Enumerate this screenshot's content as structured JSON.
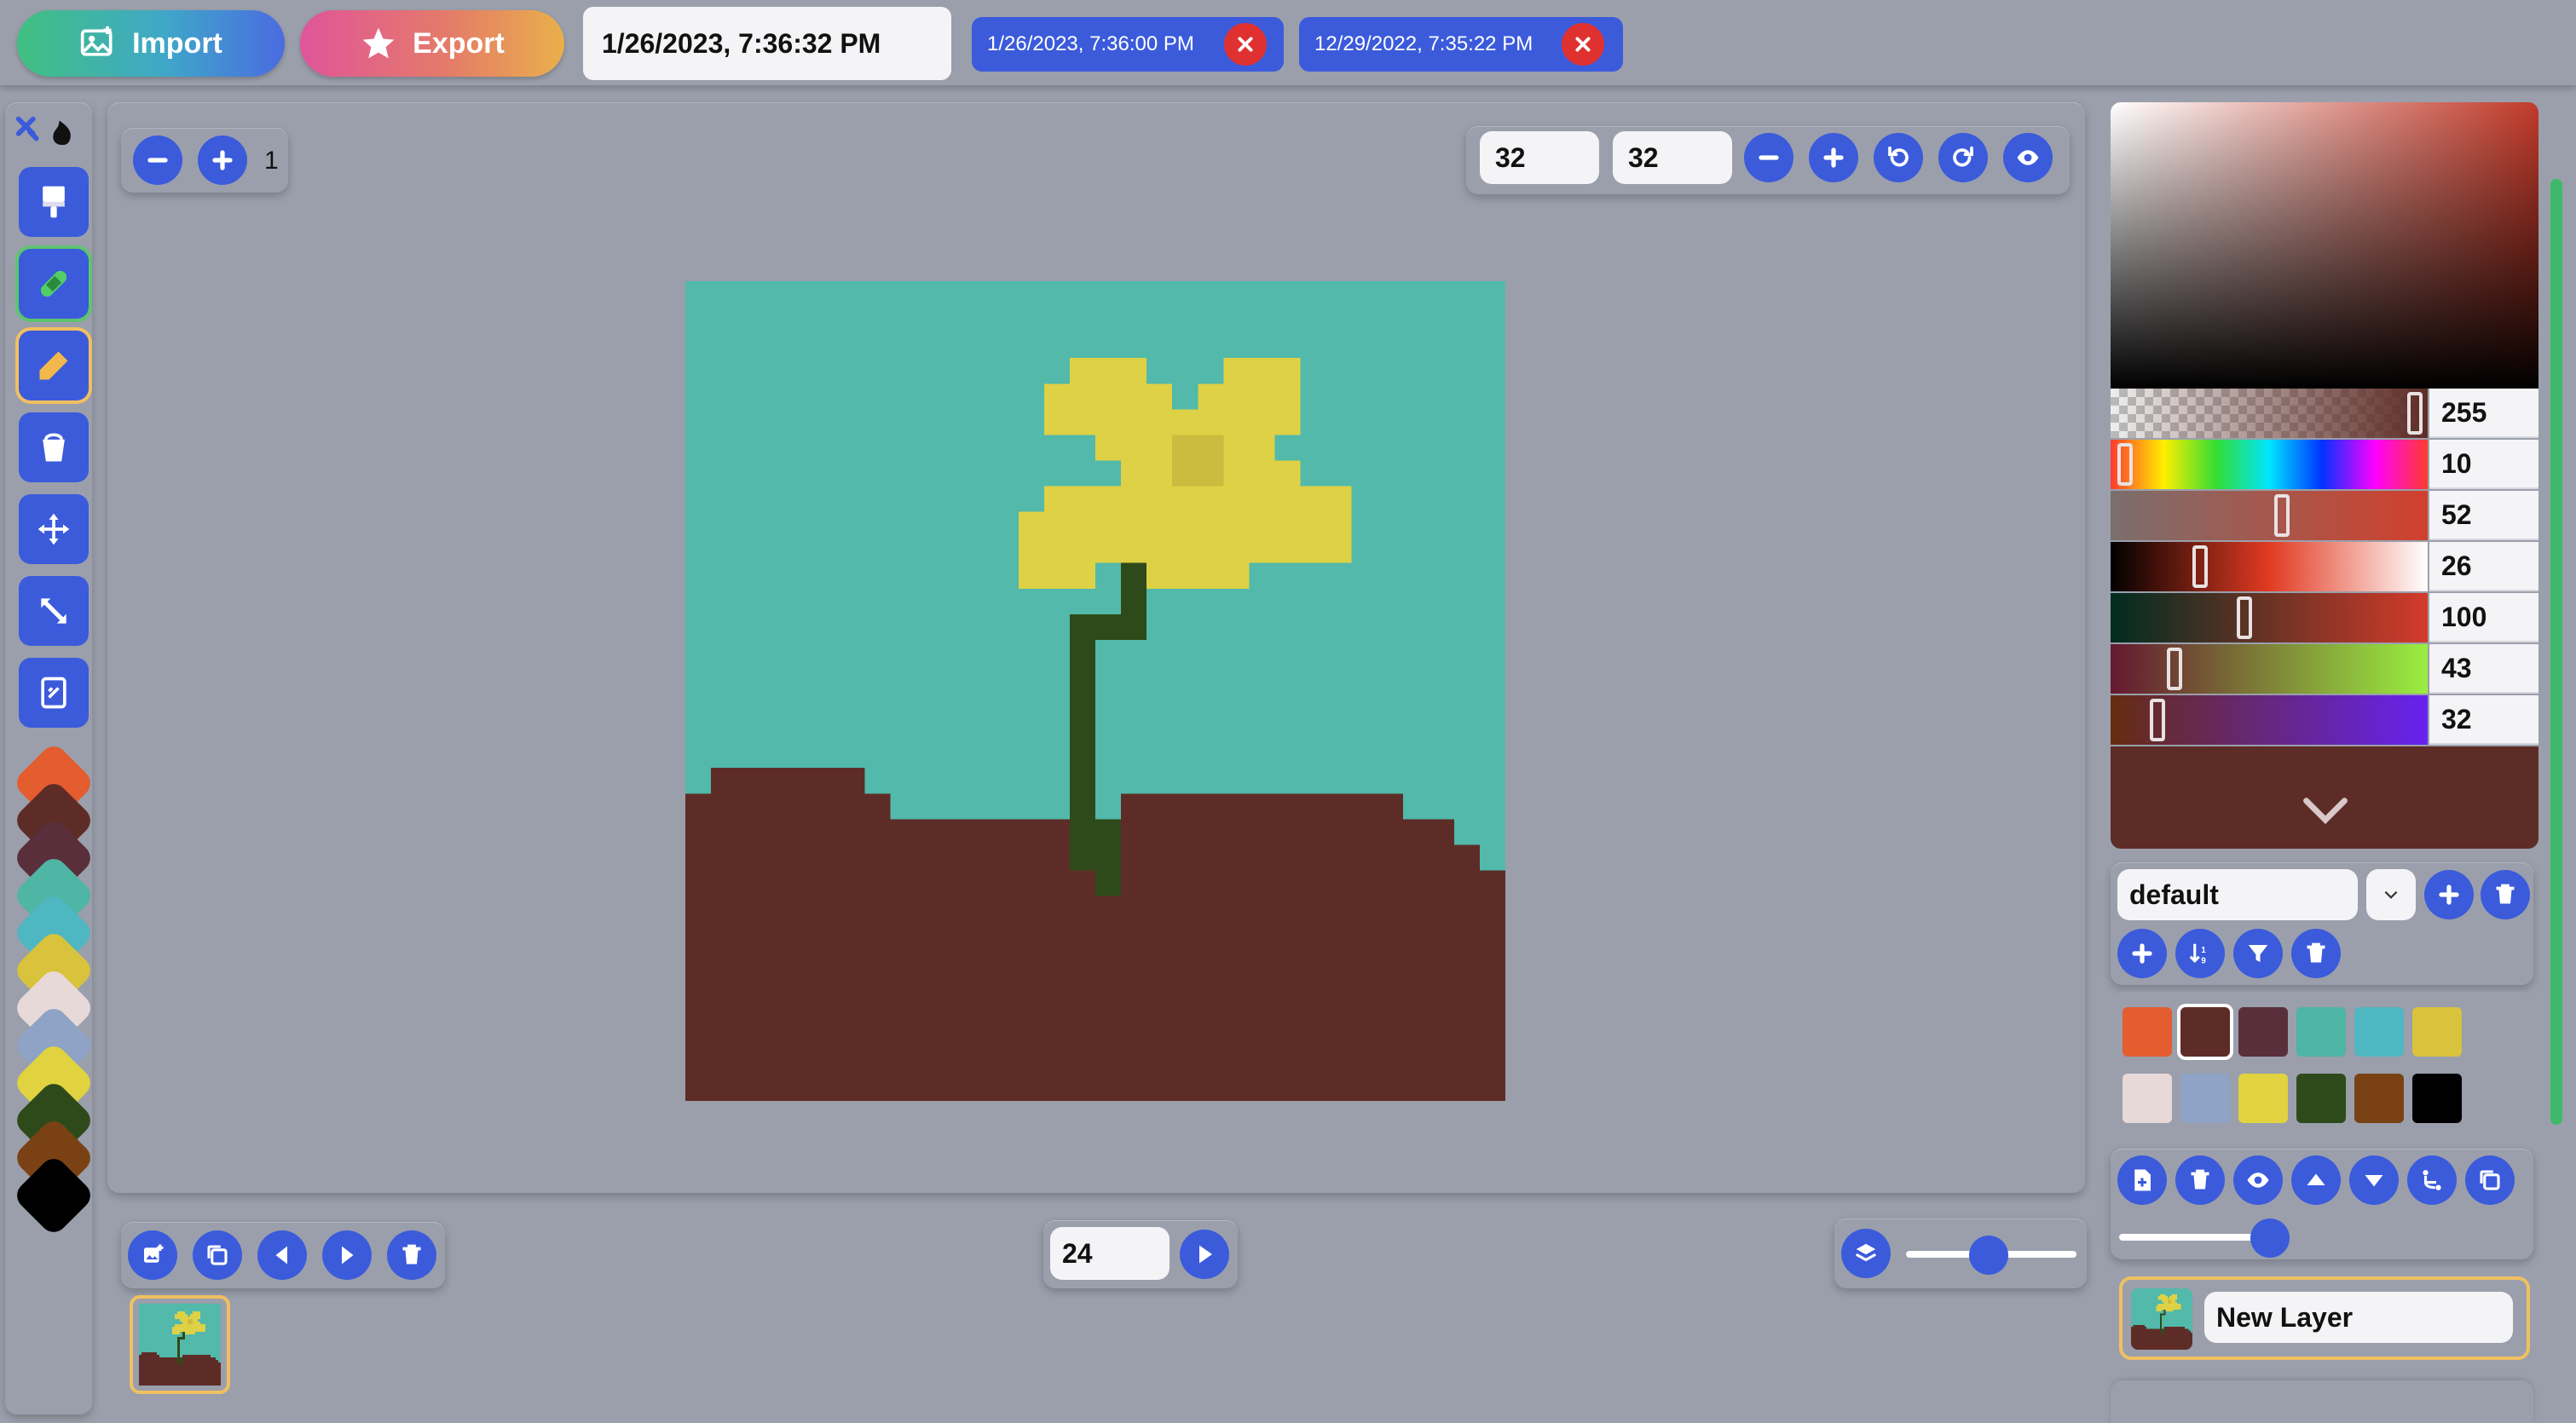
{
  "topbar": {
    "import_label": "Import",
    "export_label": "Export",
    "current_time": "1/26/2023, 7:36:32 PM",
    "saves": [
      {
        "label": "1/26/2023, 7:36:00 PM"
      },
      {
        "label": "12/29/2022, 7:35:22 PM"
      }
    ]
  },
  "zoom": {
    "value": "1"
  },
  "canvas_size": {
    "width": "32",
    "height": "32"
  },
  "animation": {
    "fps": "24"
  },
  "color": {
    "alpha": "255",
    "hue": "10",
    "saturation": "52",
    "lightness": "26",
    "red": "100",
    "green": "43",
    "blue": "32",
    "current_hex": "#5e2c26"
  },
  "palette": {
    "name": "default",
    "colors": [
      "#e35d2e",
      "#5e2c26",
      "#5a2f3c",
      "#4fb5a5",
      "#4fb7c2",
      "#d9c23c",
      "#e8d9d9",
      "#8ea3c5",
      "#e0d33f",
      "#2f4a1a",
      "#7a4214",
      "#000000"
    ],
    "selected_index": 1
  },
  "layers": [
    {
      "name": "New Layer"
    }
  ],
  "icons": {
    "import": "image-icon",
    "export": "star-icon"
  }
}
